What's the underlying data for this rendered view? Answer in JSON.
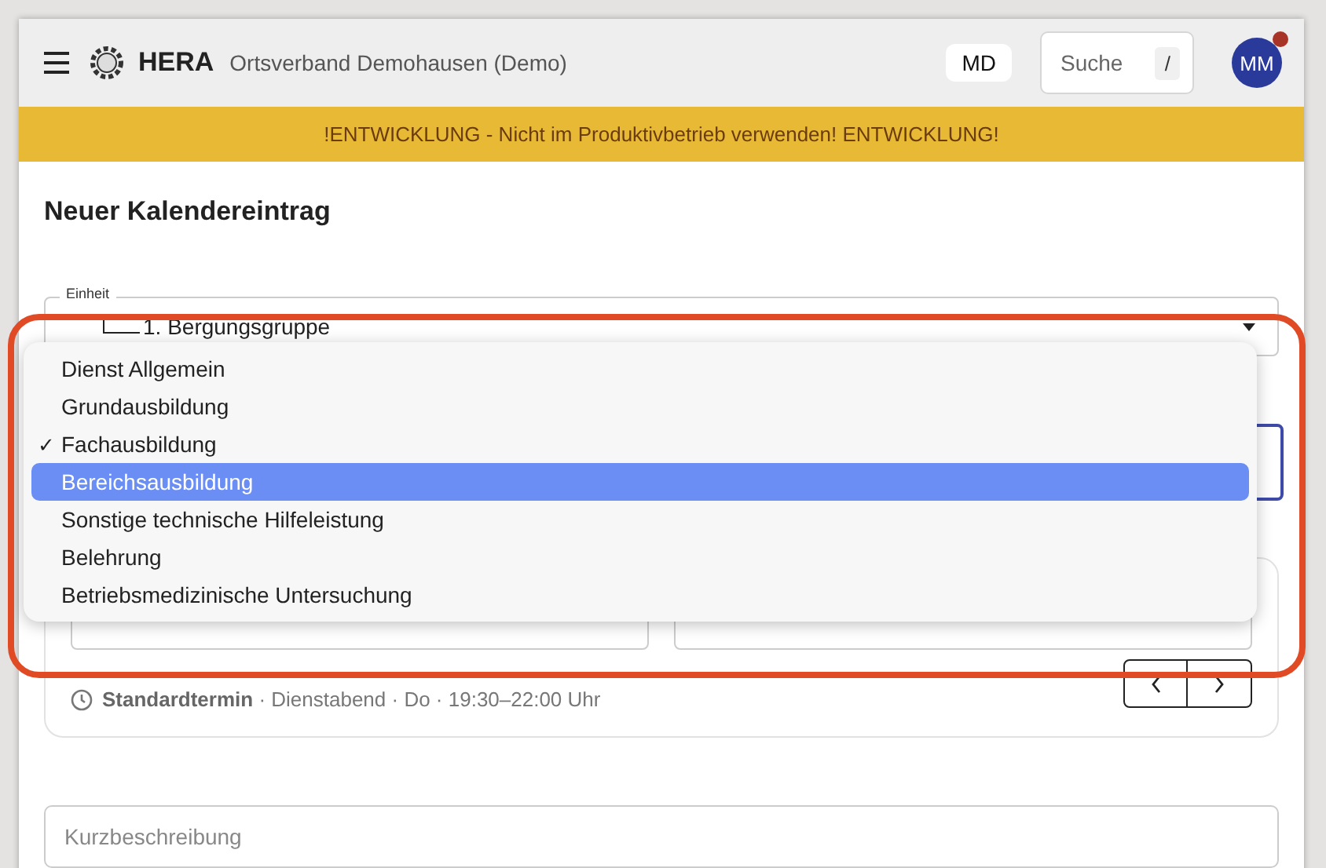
{
  "header": {
    "logo": "HERA",
    "subtitle": "Ortsverband Demohausen (Demo)",
    "unit_badge": "MD",
    "search": {
      "placeholder": "Suche",
      "shortcut": "/"
    },
    "avatar": "MM",
    "notification": true
  },
  "banner": "!ENTWICKLUNG - Nicht im Produktivbetrieb verwenden! ENTWICKLUNG!",
  "page_title": "Neuer Kalendereintrag",
  "unit_field": {
    "label": "Einheit",
    "value": "1. Bergungsgruppe"
  },
  "category_menu": {
    "check_symbol": "✓",
    "items": [
      {
        "label": "Dienst Allgemein",
        "checked": false,
        "selected": false
      },
      {
        "label": "Grundausbildung",
        "checked": false,
        "selected": false
      },
      {
        "label": "Fachausbildung",
        "checked": true,
        "selected": false
      },
      {
        "label": "Bereichsausbildung",
        "checked": false,
        "selected": true
      },
      {
        "label": "Sonstige technische Hilfeleistung",
        "checked": false,
        "selected": false
      },
      {
        "label": "Belehrung",
        "checked": false,
        "selected": false
      },
      {
        "label": "Betriebsmedizinische Untersuchung",
        "checked": false,
        "selected": false
      }
    ]
  },
  "schedule": {
    "standard_label": "Standardtermin",
    "standard_detail": "· Dienstabend · Do · 19:30–22:00 Uhr"
  },
  "short_description": {
    "placeholder": "Kurzbeschreibung"
  }
}
